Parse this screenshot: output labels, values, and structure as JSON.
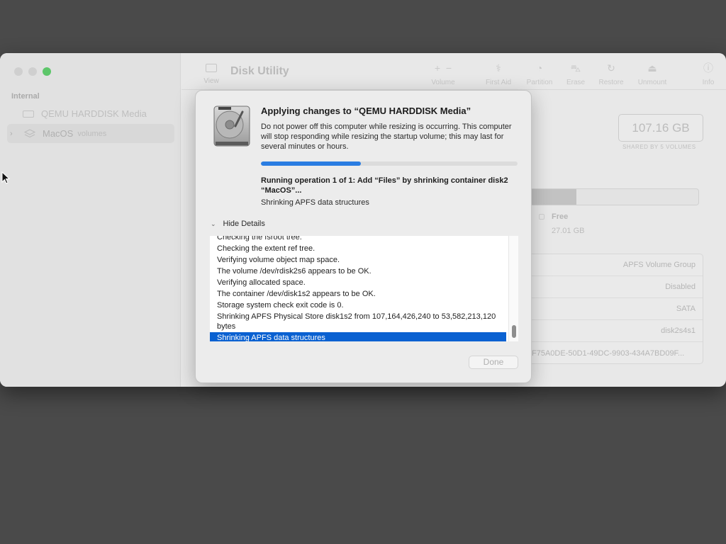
{
  "window": {
    "title": "Disk Utility",
    "view_label": "View"
  },
  "sidebar": {
    "section_label": "Internal",
    "items": [
      {
        "label": "QEMU HARDDISK Media",
        "sub": ""
      },
      {
        "label": "MacOS",
        "sub": "volumes"
      }
    ]
  },
  "toolbar": {
    "buttons": [
      {
        "label": "Volume",
        "icon": "plus-minus-icon"
      },
      {
        "label": "First Aid",
        "icon": "stethoscope-icon"
      },
      {
        "label": "Partition",
        "icon": "pie-icon"
      },
      {
        "label": "Erase",
        "icon": "car-icon"
      },
      {
        "label": "Restore",
        "icon": "restore-icon"
      },
      {
        "label": "Unmount",
        "icon": "eject-icon"
      },
      {
        "label": "Info",
        "icon": "info-icon"
      }
    ]
  },
  "main": {
    "capacity": "107.16 GB",
    "capacity_sub": "SHARED BY 5 VOLUMES",
    "used_fraction": 0.28,
    "free_label": "Free",
    "free_value": "27.01 GB",
    "info_rows": [
      "APFS Volume Group",
      "Disabled",
      "SATA",
      "disk2s4s1",
      "F75A0DE-50D1-49DC-9903-434A7BD09F..."
    ]
  },
  "sheet": {
    "title": "Applying changes to “QEMU HARDDISK Media”",
    "message": "Do not power off this computer while resizing is occurring. This computer will stop responding while resizing the startup volume; this may last for several minutes or hours.",
    "progress_fraction": 0.39,
    "operation": "Running operation 1 of 1: Add “Files” by shrinking container disk2 “MacOS”...",
    "status": "Shrinking APFS data structures",
    "details_toggle": "Hide Details",
    "log_lines": [
      "Checking the fsroot tree.",
      "Checking the extent ref tree.",
      "Verifying volume object map space.",
      "The volume /dev/rdisk2s6 appears to be OK.",
      "Verifying allocated space.",
      "The container /dev/disk1s2 appears to be OK.",
      "Storage system check exit code is 0.",
      "Shrinking APFS Physical Store disk1s2 from 107,164,426,240 to 53,582,213,120 bytes",
      "Shrinking APFS data structures"
    ],
    "selected_line_index": 8,
    "done_label": "Done",
    "colors": {
      "progress": "#2a7de2",
      "selection": "#0a61d1"
    }
  }
}
